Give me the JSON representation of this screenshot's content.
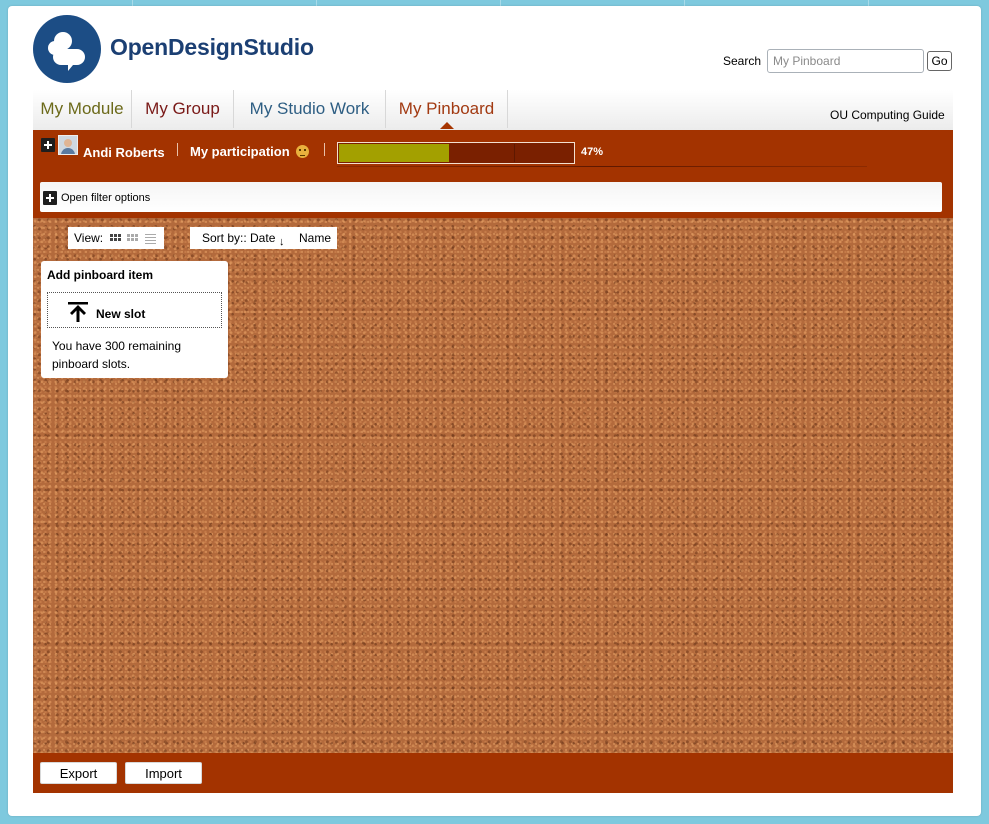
{
  "header": {
    "brand": "OpenDesignStudio",
    "search_label": "Search",
    "search_placeholder": "My Pinboard",
    "go_label": "Go"
  },
  "tabs": [
    {
      "label": "My Module",
      "color": "#6c6a1a"
    },
    {
      "label": "My Group",
      "color": "#7a1a18"
    },
    {
      "label": "My Studio Work",
      "color": "#2e5e83"
    },
    {
      "label": "My Pinboard",
      "color": "#a23a12",
      "active": true
    }
  ],
  "guide_link": "OU Computing Guide",
  "participation": {
    "user_name": "Andi Roberts",
    "label": "My participation",
    "percent_text": "47%",
    "progress": 0.47
  },
  "filter": {
    "label": "Open filter options"
  },
  "board_toolbar": {
    "view_label": "View:",
    "sort_label": "Sort by:: Date",
    "sort_name": "Name"
  },
  "add_card": {
    "title": "Add pinboard item",
    "new_slot_label": "New slot",
    "remaining_text": "You have 300 remaining pinboard slots."
  },
  "footer": {
    "export_label": "Export",
    "import_label": "Import"
  },
  "colors": {
    "brand_blue": "#1c4d85",
    "bar_rust": "#a33300",
    "progress_fill": "#a3a000"
  }
}
